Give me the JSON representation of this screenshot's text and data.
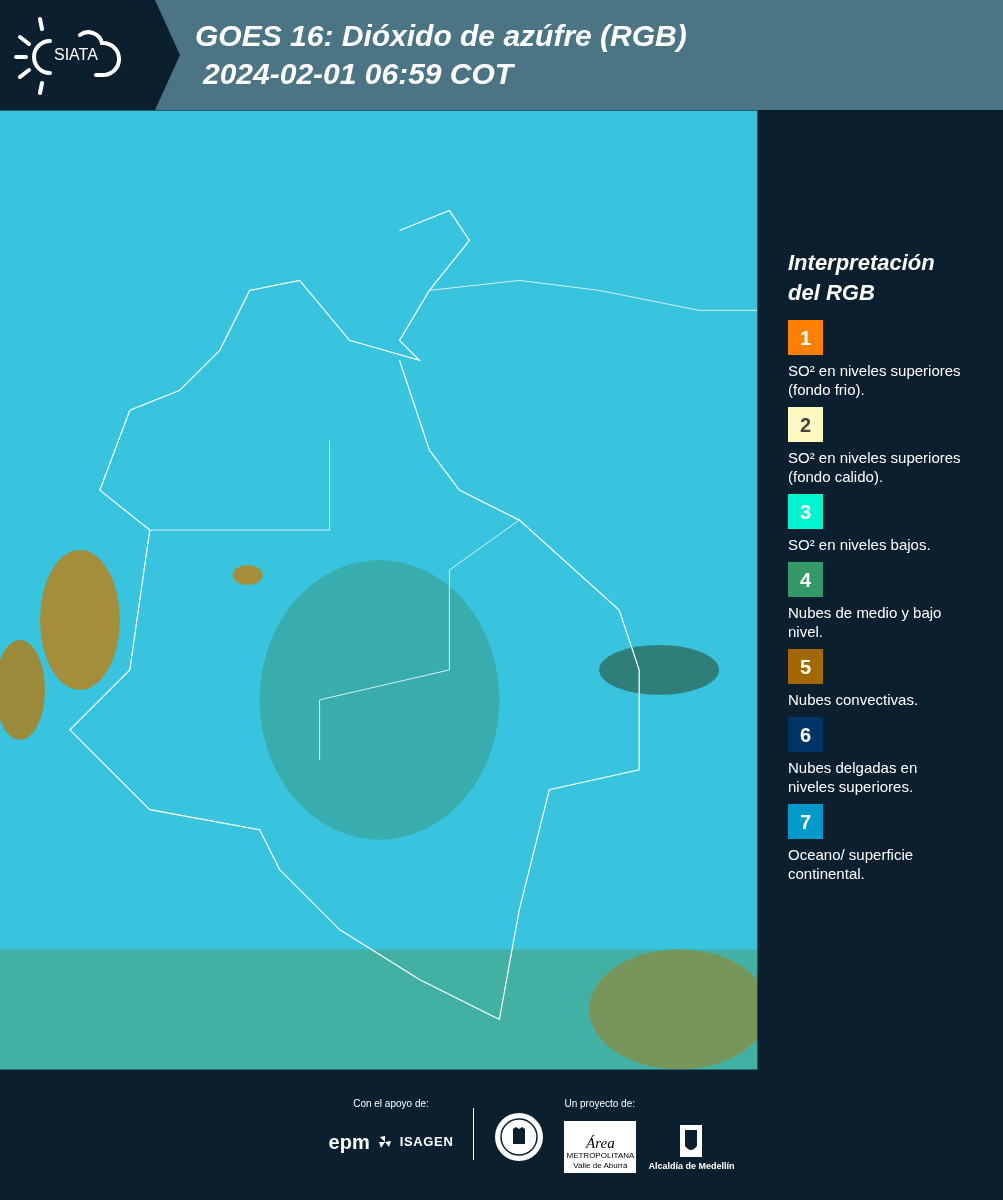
{
  "header": {
    "logo_text": "SIATA",
    "title_line_1": "GOES 16: Dióxido de azúfre (RGB)",
    "title_line_2": "2024-02-01 06:59 COT"
  },
  "legend": {
    "title": "Interpretación del RGB",
    "items": [
      {
        "number": "1",
        "color": "#ff7f00",
        "description": "SO² en niveles superiores (fondo frio)."
      },
      {
        "number": "2",
        "color": "#fff8c0",
        "description": "SO² en niveles superiores (fondo calido)."
      },
      {
        "number": "3",
        "color": "#00f5d0",
        "description": "SO² en niveles bajos."
      },
      {
        "number": "4",
        "color": "#339966",
        "description": "Nubes de medio y bajo nivel."
      },
      {
        "number": "5",
        "color": "#a36800",
        "description": "Nubes convectivas."
      },
      {
        "number": "6",
        "color": "#003366",
        "description": "Nubes delgadas en niveles superiores."
      },
      {
        "number": "7",
        "color": "#0099cc",
        "description": "Oceano/ superficie continental."
      }
    ]
  },
  "footer": {
    "support_label": "Con el apoyo de:",
    "support_logos": [
      "epm",
      "ISAGEN"
    ],
    "project_label": "Un proyecto de:",
    "area_logo": [
      "Área",
      "METROPOLITANA",
      "Valle de Aburrá"
    ],
    "alcaldia_logo": "Alcaldía de Medellín"
  }
}
